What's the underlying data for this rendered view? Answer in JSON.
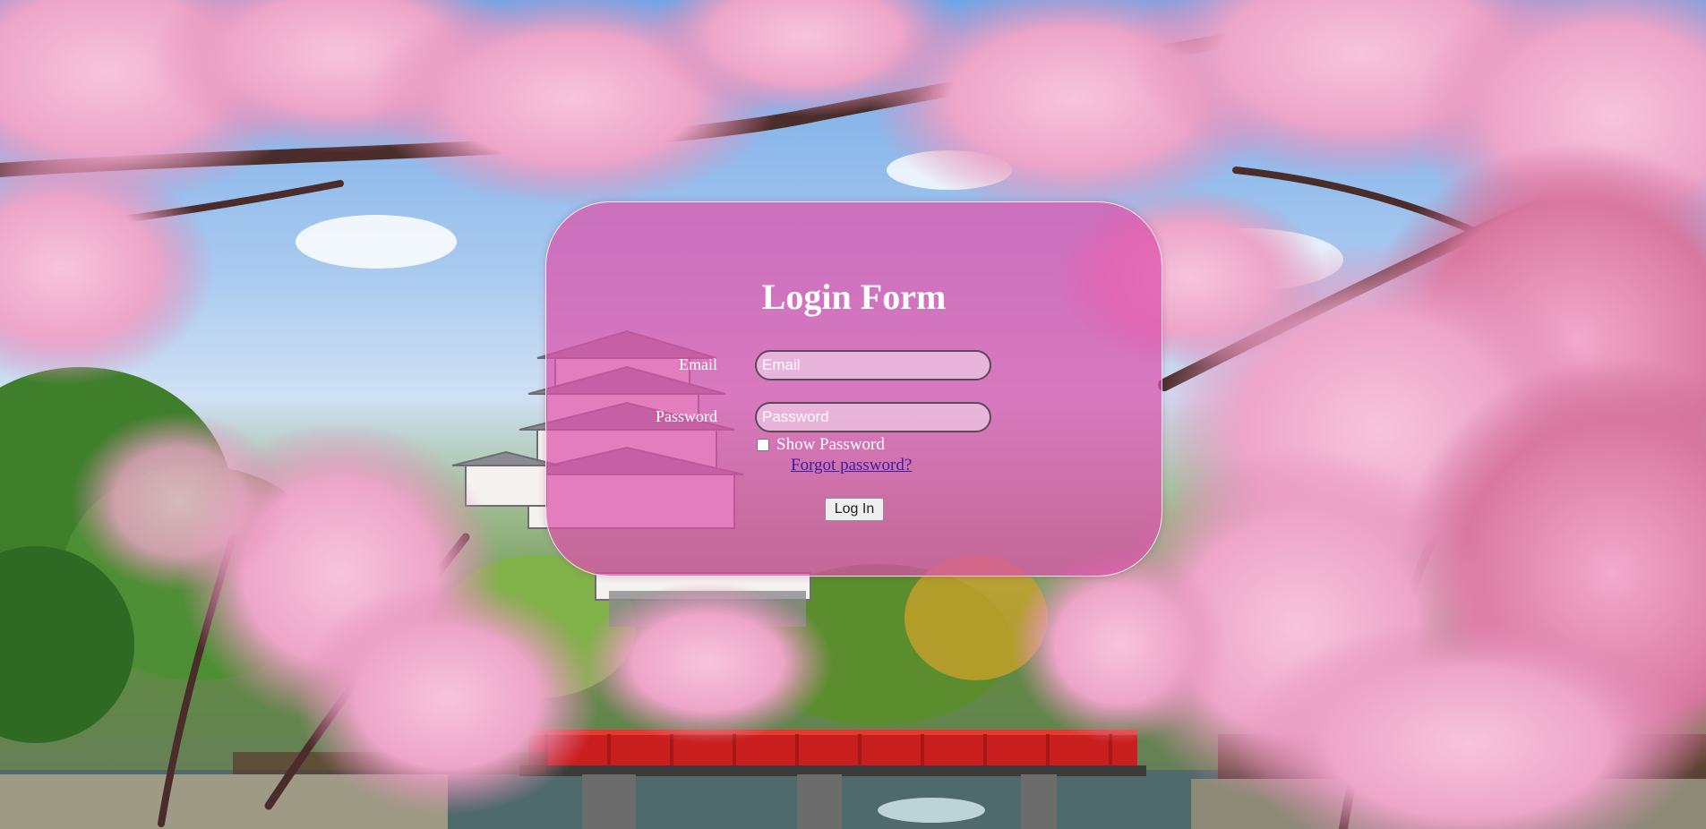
{
  "form": {
    "title": "Login Form",
    "email_label": "Email",
    "email_placeholder": "Email",
    "email_value": "",
    "password_label": "Password",
    "password_placeholder": "Password",
    "password_value": "",
    "show_password_label": "Show Password",
    "show_password_checked": false,
    "forgot_password_link": "Forgot password?",
    "login_button": "Log In"
  },
  "colors": {
    "card_background": "#dd50aa",
    "link": "#3a1aa8",
    "text": "#ffffff"
  }
}
